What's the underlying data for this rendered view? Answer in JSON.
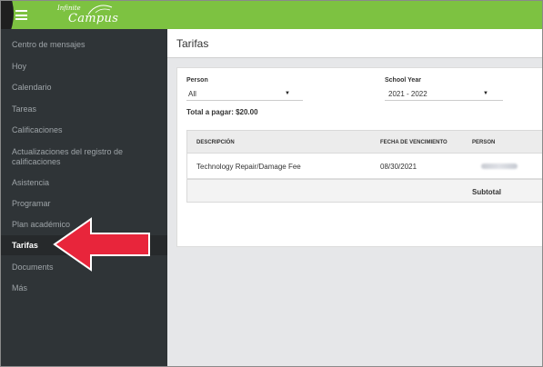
{
  "app": {
    "logo_line1": "Infinite",
    "logo_line2": "Campus"
  },
  "sidebar": {
    "items": [
      {
        "label": "Centro de mensajes",
        "active": false
      },
      {
        "label": "Hoy",
        "active": false
      },
      {
        "label": "Calendario",
        "active": false
      },
      {
        "label": "Tareas",
        "active": false
      },
      {
        "label": "Calificaciones",
        "active": false
      },
      {
        "label": "Actualizaciones del registro de calificaciones",
        "active": false
      },
      {
        "label": "Asistencia",
        "active": false
      },
      {
        "label": "Programar",
        "active": false
      },
      {
        "label": "Plan académico",
        "active": false
      },
      {
        "label": "Tarifas",
        "active": true
      },
      {
        "label": "Documents",
        "active": false
      },
      {
        "label": "Más",
        "active": false
      }
    ]
  },
  "page": {
    "title": "Tarifas",
    "person_label": "Person",
    "person_value": "All",
    "year_label": "School Year",
    "year_value": "2021 - 2022",
    "total": "Total a pagar: $20.00"
  },
  "table": {
    "columns": [
      "DESCRIPCIÓN",
      "FECHA DE VENCIMIENTO",
      "PERSON"
    ],
    "rows": [
      {
        "description": "Technology Repair/Damage Fee",
        "due_date": "08/30/2021"
      }
    ],
    "subtotal_label": "Subtotal"
  },
  "colors": {
    "brand_green": "#7dc241",
    "sidebar_bg": "#2f3437",
    "arrow_red": "#e8253b"
  }
}
